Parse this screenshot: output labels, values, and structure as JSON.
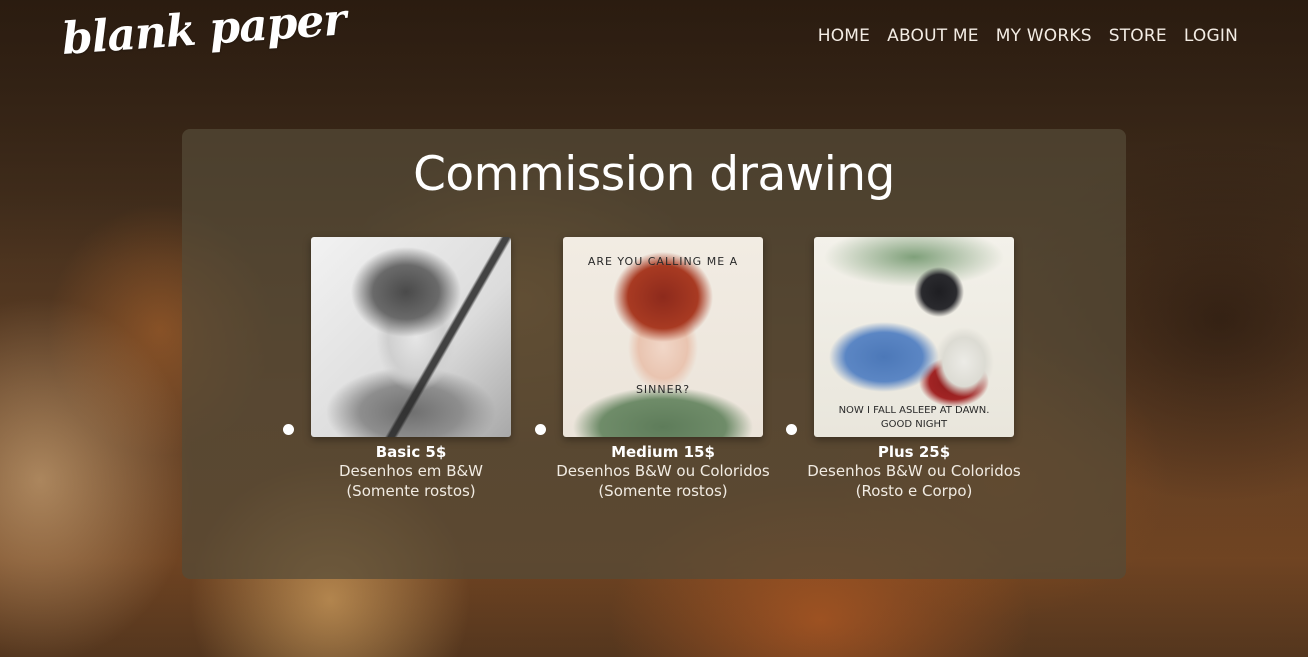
{
  "header": {
    "logo": "blank paper",
    "nav": [
      "HOME",
      "ABOUT ME",
      "MY WORKS",
      "STORE",
      "LOGIN"
    ]
  },
  "panel": {
    "title": "Commission drawing",
    "cards": [
      {
        "name": "Basic 5$",
        "desc_line1": "Desenhos em B&W",
        "desc_line2": "(Somente rostos)"
      },
      {
        "name": "Medium 15$",
        "desc_line1": "Desenhos B&W ou Coloridos",
        "desc_line2": "(Somente rostos)",
        "art_text_top": "ARE YOU CALLING ME A",
        "art_text_bottom": "SINNER?"
      },
      {
        "name": "Plus 25$",
        "desc_line1": "Desenhos B&W ou Coloridos",
        "desc_line2": "(Rosto e Corpo)",
        "art_text_line1": "NOW I FALL ASLEEP AT DAWN.",
        "art_text_line2": "GOOD NIGHT"
      }
    ]
  },
  "colors": {
    "panel_bg": "#554b37",
    "text": "#ffffff"
  }
}
